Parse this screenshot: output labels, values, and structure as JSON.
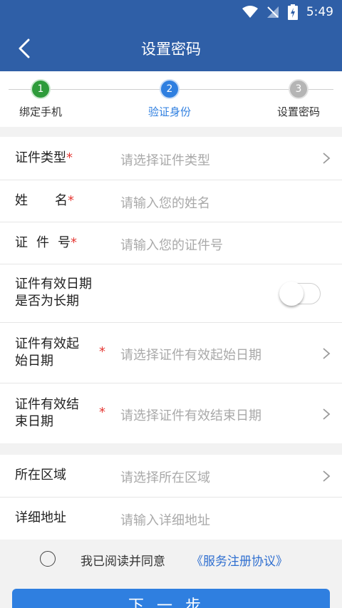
{
  "status_bar": {
    "time": "5:49"
  },
  "header": {
    "title": "设置密码"
  },
  "stepper": {
    "steps": [
      {
        "number": "1",
        "label": "绑定手机",
        "color": "#2e9b3a"
      },
      {
        "number": "2",
        "label": "验证身份",
        "color": "#2f7fe0"
      },
      {
        "number": "3",
        "label": "设置密码",
        "color": "#b5b5b5"
      }
    ]
  },
  "identity": {
    "id_type": {
      "label": "证件类型",
      "required": "*",
      "placeholder": "请选择证件类型"
    },
    "name": {
      "label_first": "姓",
      "label_second": "名",
      "required": "*",
      "placeholder": "请输入您的姓名"
    },
    "id_number": {
      "label_a": "证",
      "label_b": "件",
      "label_c": "号",
      "required": "*",
      "placeholder": "请输入您的证件号"
    },
    "long_term": {
      "line1": "证件有效日期",
      "line2": "是否为长期",
      "toggle_on": false
    },
    "start_date": {
      "line1": "证件有效起",
      "line2": "始日期",
      "required": "*",
      "placeholder": "请选择证件有效起始日期"
    },
    "end_date": {
      "line1": "证件有效结",
      "line2": "束日期",
      "required": "*",
      "placeholder": "请选择证件有效结束日期"
    }
  },
  "address": {
    "region": {
      "label": "所在区域",
      "placeholder": "请选择所在区域"
    },
    "detail": {
      "label": "详细地址",
      "placeholder": "请输入详细地址"
    }
  },
  "agreement": {
    "text": "我已阅读并同意",
    "link": "《服务注册协议》",
    "checked": false
  },
  "next_button": {
    "label": "下一步"
  },
  "colors": {
    "primary": "#2f5fa7",
    "accent": "#2f7fe0",
    "required": "#e53935"
  }
}
